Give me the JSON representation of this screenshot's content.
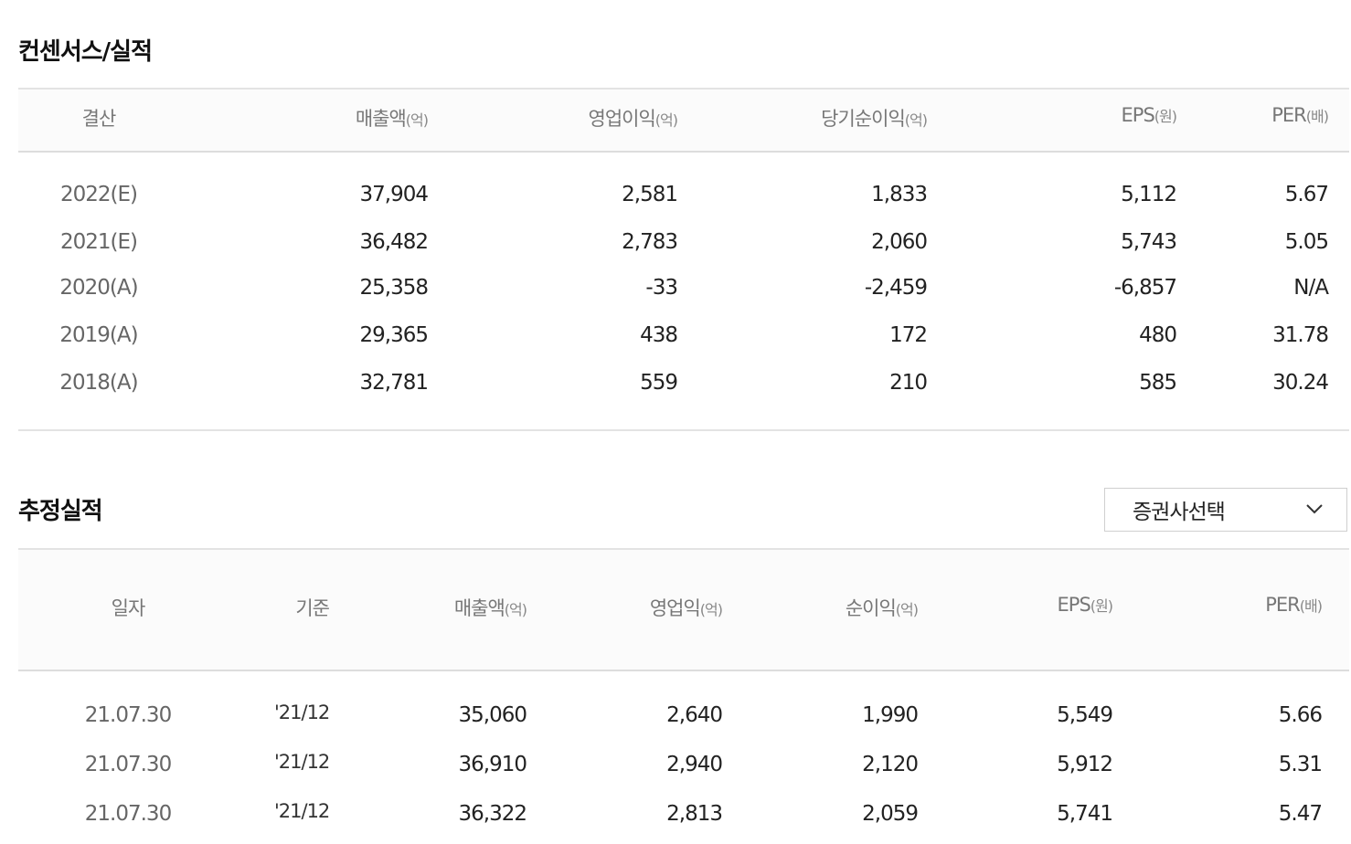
{
  "consensus": {
    "title": "컨센서스/실적",
    "headers": {
      "period": "결산",
      "revenue": "매출액",
      "revenue_unit": "(억)",
      "operating_profit": "영업이익",
      "operating_profit_unit": "(억)",
      "net_income": "당기순이익",
      "net_income_unit": "(억)",
      "eps": "EPS",
      "eps_unit": "(원)",
      "per": "PER",
      "per_unit": "(배)"
    },
    "rows": [
      {
        "period": "2022(E)",
        "revenue": "37,904",
        "operating_profit": "2,581",
        "net_income": "1,833",
        "eps": "5,112",
        "per": "5.67"
      },
      {
        "period": "2021(E)",
        "revenue": "36,482",
        "operating_profit": "2,783",
        "net_income": "2,060",
        "eps": "5,743",
        "per": "5.05"
      },
      {
        "period": "2020(A)",
        "revenue": "25,358",
        "operating_profit": "-33",
        "net_income": "-2,459",
        "eps": "-6,857",
        "per": "N/A"
      },
      {
        "period": "2019(A)",
        "revenue": "29,365",
        "operating_profit": "438",
        "net_income": "172",
        "eps": "480",
        "per": "31.78"
      },
      {
        "period": "2018(A)",
        "revenue": "32,781",
        "operating_profit": "559",
        "net_income": "210",
        "eps": "585",
        "per": "30.24"
      }
    ]
  },
  "estimates": {
    "title": "추정실적",
    "broker_select": {
      "value": "증권사선택",
      "icon": "chevron-down-icon"
    },
    "headers": {
      "date": "일자",
      "basis": "기준",
      "revenue": "매출액",
      "revenue_unit": "(억)",
      "operating_profit": "영업익",
      "operating_profit_unit": "(억)",
      "net_income": "순이익",
      "net_income_unit": "(억)",
      "eps": "EPS",
      "eps_unit": "(원)",
      "per": "PER",
      "per_unit": "(배)"
    },
    "rows": [
      {
        "date": "21.07.30",
        "basis": "'21/12",
        "revenue": "35,060",
        "operating_profit": "2,640",
        "net_income": "1,990",
        "eps": "5,549",
        "per": "5.66"
      },
      {
        "date": "21.07.30",
        "basis": "'21/12",
        "revenue": "36,910",
        "operating_profit": "2,940",
        "net_income": "2,120",
        "eps": "5,912",
        "per": "5.31"
      },
      {
        "date": "21.07.30",
        "basis": "'21/12",
        "revenue": "36,322",
        "operating_profit": "2,813",
        "net_income": "2,059",
        "eps": "5,741",
        "per": "5.47"
      }
    ]
  }
}
